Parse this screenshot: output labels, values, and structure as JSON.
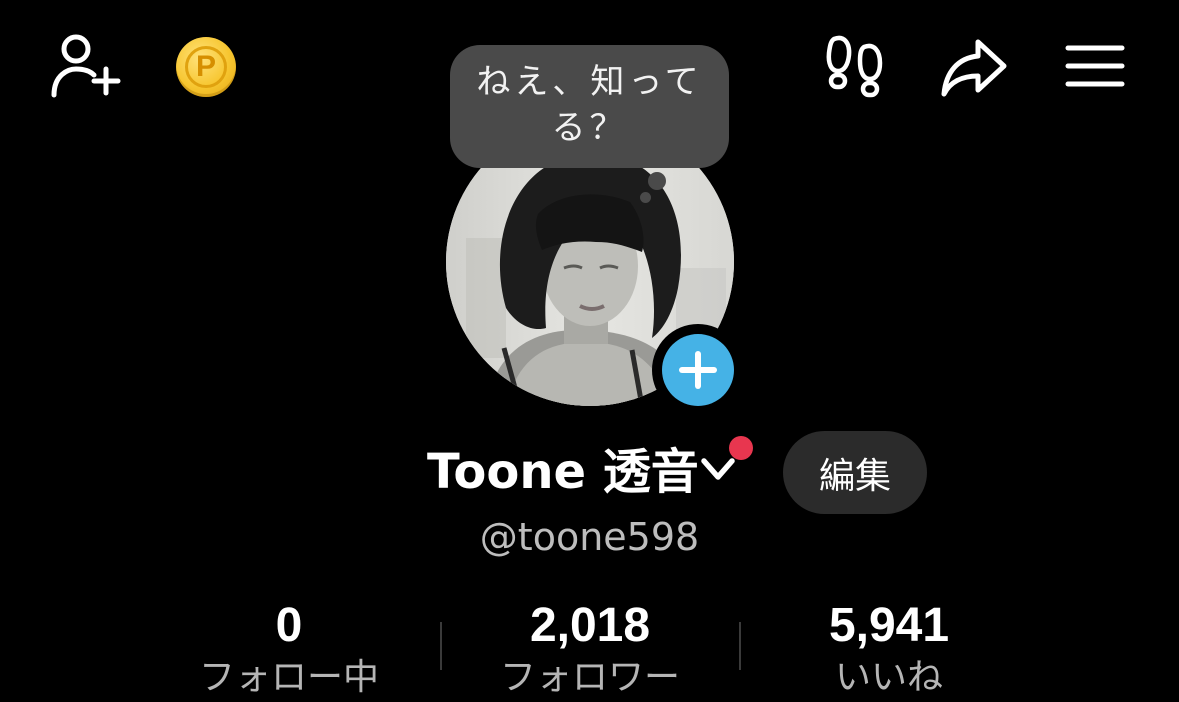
{
  "header": {
    "icons": {
      "add_friend": "person-plus-icon",
      "coin": "points-coin-icon",
      "footprints": "footprints-icon",
      "share": "share-arrow-icon",
      "menu": "hamburger-menu-icon"
    },
    "coin_letter": "P"
  },
  "status_bubble": {
    "text_line1": "ねえ、知って",
    "text_line2": "る？"
  },
  "profile": {
    "avatar": "profile-photo",
    "display_name": "Toone 透音",
    "handle": "@toone598",
    "edit_label": "編集",
    "has_notification": true
  },
  "stats": [
    {
      "value": "0",
      "label": "フォロー中"
    },
    {
      "value": "2,018",
      "label": "フォロワー"
    },
    {
      "value": "5,941",
      "label": "いいね"
    }
  ],
  "colors": {
    "background": "#000000",
    "bubble": "#4a4a4a",
    "add_button": "#45b2e6",
    "notification_dot": "#e8364f",
    "edit_button": "#2b2b2b",
    "coin": "#f7c630"
  }
}
